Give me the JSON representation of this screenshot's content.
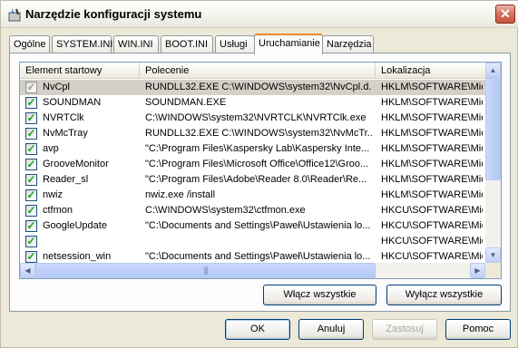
{
  "window": {
    "title": "Narzędzie konfiguracji systemu",
    "close_glyph": "✕"
  },
  "tabs": [
    {
      "label": "Ogólne"
    },
    {
      "label": "SYSTEM.INI"
    },
    {
      "label": "WIN.INI"
    },
    {
      "label": "BOOT.INI"
    },
    {
      "label": "Usługi"
    },
    {
      "label": "Uruchamianie",
      "active": true
    },
    {
      "label": "Narzędzia"
    }
  ],
  "startup": {
    "columns": [
      "Element startowy",
      "Polecenie",
      "Lokalizacja"
    ],
    "rows": [
      {
        "checked": true,
        "selected": true,
        "name": "NvCpl",
        "command": "RUNDLL32.EXE C:\\WINDOWS\\system32\\NvCpl.d...",
        "location": "HKLM\\SOFTWARE\\Micro"
      },
      {
        "checked": true,
        "name": "SOUNDMAN",
        "command": "SOUNDMAN.EXE",
        "location": "HKLM\\SOFTWARE\\Micro"
      },
      {
        "checked": true,
        "name": "NVRTClk",
        "command": "C:\\WINDOWS\\system32\\NVRTCLK\\NVRTClk.exe",
        "location": "HKLM\\SOFTWARE\\Micro"
      },
      {
        "checked": true,
        "name": "NvMcTray",
        "command": "RUNDLL32.EXE C:\\WINDOWS\\system32\\NvMcTr...",
        "location": "HKLM\\SOFTWARE\\Micro"
      },
      {
        "checked": true,
        "name": "avp",
        "command": "\"C:\\Program Files\\Kaspersky Lab\\Kaspersky Inte...",
        "location": "HKLM\\SOFTWARE\\Micro"
      },
      {
        "checked": true,
        "name": "GrooveMonitor",
        "command": "\"C:\\Program Files\\Microsoft Office\\Office12\\Groo...",
        "location": "HKLM\\SOFTWARE\\Micro"
      },
      {
        "checked": true,
        "name": "Reader_sl",
        "command": "\"C:\\Program Files\\Adobe\\Reader 8.0\\Reader\\Re...",
        "location": "HKLM\\SOFTWARE\\Micro"
      },
      {
        "checked": true,
        "name": "nwiz",
        "command": "nwiz.exe /install",
        "location": "HKLM\\SOFTWARE\\Micro"
      },
      {
        "checked": true,
        "name": "ctfmon",
        "command": "C:\\WINDOWS\\system32\\ctfmon.exe",
        "location": "HKCU\\SOFTWARE\\Micro"
      },
      {
        "checked": true,
        "name": "GoogleUpdate",
        "command": "\"C:\\Documents and Settings\\Paweł\\Ustawienia lo...",
        "location": "HKCU\\SOFTWARE\\Micro"
      },
      {
        "checked": true,
        "name": "",
        "command": "",
        "location": "HKCU\\SOFTWARE\\Micro"
      },
      {
        "checked": true,
        "name": "netsession_win",
        "command": "\"C:\\Documents and Settings\\Paweł\\Ustawienia lo...",
        "location": "HKCU\\SOFTWARE\\Micro"
      }
    ],
    "scroll": {
      "up": "▲",
      "down": "▼",
      "left": "◀",
      "right": "▶",
      "grip": "|||"
    }
  },
  "buttons": {
    "enable_all": "Włącz wszystkie",
    "disable_all": "Wyłącz wszystkie",
    "ok": "OK",
    "cancel": "Anuluj",
    "apply": "Zastosuj",
    "help": "Pomoc"
  },
  "colors": {
    "accent_tab": "#e68b2c",
    "check": "#21a121",
    "close": "#d46f5c"
  }
}
